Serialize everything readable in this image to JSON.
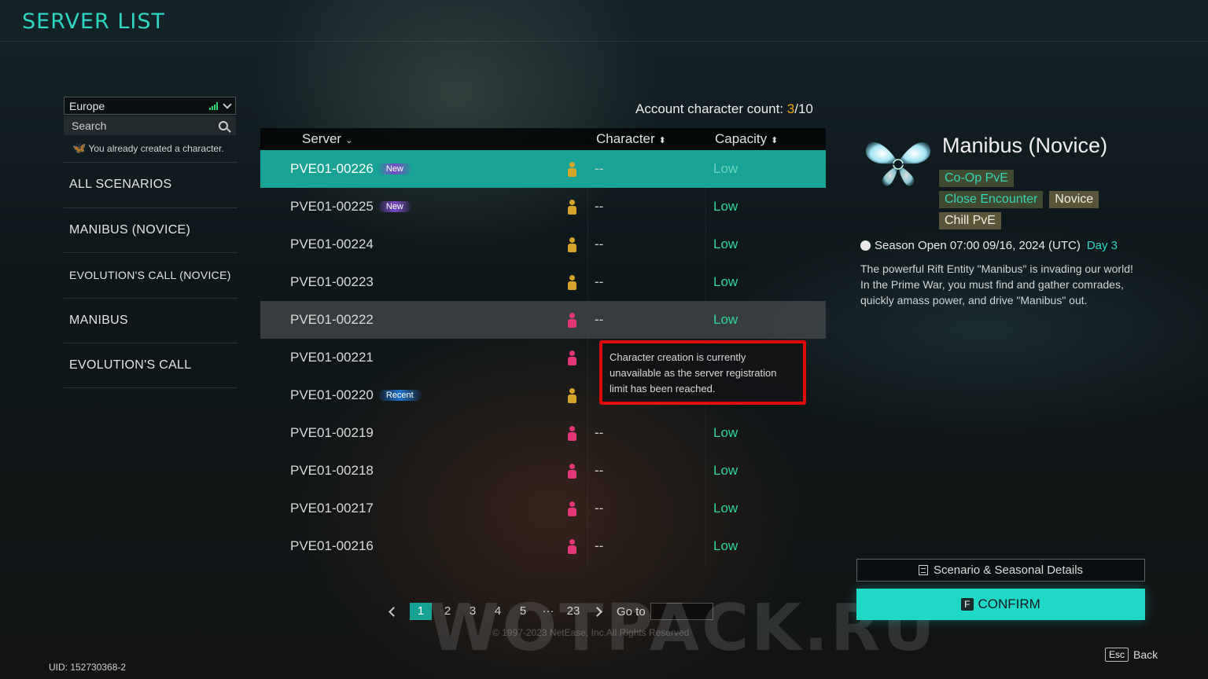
{
  "title": "SERVER LIST",
  "sidebar": {
    "region": "Europe",
    "search_placeholder": "Search",
    "created_note": "You already created a character.",
    "categories": [
      {
        "label": "ALL SCENARIOS"
      },
      {
        "label": "MANIBUS (NOVICE)"
      },
      {
        "label": "EVOLUTION'S CALL (NOVICE)"
      },
      {
        "label": "MANIBUS"
      },
      {
        "label": "EVOLUTION'S CALL"
      }
    ]
  },
  "account": {
    "label": "Account character count: ",
    "count": "3",
    "total": "/10"
  },
  "table": {
    "headers": {
      "server": "Server",
      "character": "Character",
      "capacity": "Capacity"
    },
    "rows": [
      {
        "server": "PVE01-00226",
        "tag": "New",
        "figure": "gold",
        "character": "--",
        "capacity": "Low"
      },
      {
        "server": "PVE01-00225",
        "tag": "New",
        "figure": "gold",
        "character": "--",
        "capacity": "Low"
      },
      {
        "server": "PVE01-00224",
        "tag": "",
        "figure": "gold",
        "character": "--",
        "capacity": "Low"
      },
      {
        "server": "PVE01-00223",
        "tag": "",
        "figure": "gold",
        "character": "--",
        "capacity": "Low"
      },
      {
        "server": "PVE01-00222",
        "tag": "",
        "figure": "pink",
        "character": "--",
        "capacity": "Low"
      },
      {
        "server": "PVE01-00221",
        "tag": "",
        "figure": "pink",
        "character": "",
        "capacity": ""
      },
      {
        "server": "PVE01-00220",
        "tag": "Recent",
        "figure": "gold",
        "character": "",
        "capacity": ""
      },
      {
        "server": "PVE01-00219",
        "tag": "",
        "figure": "pink",
        "character": "--",
        "capacity": "Low"
      },
      {
        "server": "PVE01-00218",
        "tag": "",
        "figure": "pink",
        "character": "--",
        "capacity": "Low"
      },
      {
        "server": "PVE01-00217",
        "tag": "",
        "figure": "pink",
        "character": "--",
        "capacity": "Low"
      },
      {
        "server": "PVE01-00216",
        "tag": "",
        "figure": "pink",
        "character": "--",
        "capacity": "Low"
      }
    ]
  },
  "tooltip": "Character creation is currently unavailable as the server registration limit has been reached.",
  "pagination": {
    "pages": [
      "1",
      "2",
      "3",
      "4",
      "5",
      "···",
      "23"
    ],
    "active": "1",
    "goto_label": "Go to"
  },
  "copyright": "© 1997-2023 NetEase, Inc.All Rights Reserved",
  "watermark": "WOTPACK.RU",
  "scenario": {
    "title": "Manibus (Novice)",
    "badges": [
      {
        "label": "Co-Op PvE",
        "style": "g"
      },
      {
        "label": "Close Encounter",
        "style": "g"
      },
      {
        "label": "Novice",
        "style": "n"
      },
      {
        "label": "Chill PvE",
        "style": "n"
      }
    ],
    "season": "Season Open 07:00 09/16, 2024 (UTC)",
    "day": "Day 3",
    "description": "The powerful Rift Entity \"Manibus\" is invading our world! In the Prime War, you must find and gather comrades, quickly amass power, and drive \"Manibus\" out."
  },
  "buttons": {
    "details": "Scenario & Seasonal Details",
    "confirm_key": "F",
    "confirm": "CONFIRM",
    "back_key": "Esc",
    "back": "Back"
  },
  "uid": "UID: 152730368-2",
  "colors": {
    "accent": "#1fd9c6",
    "selected_row": "#18a394",
    "capacity_low": "#2fd69a",
    "highlight_border": "#e00a0a"
  }
}
